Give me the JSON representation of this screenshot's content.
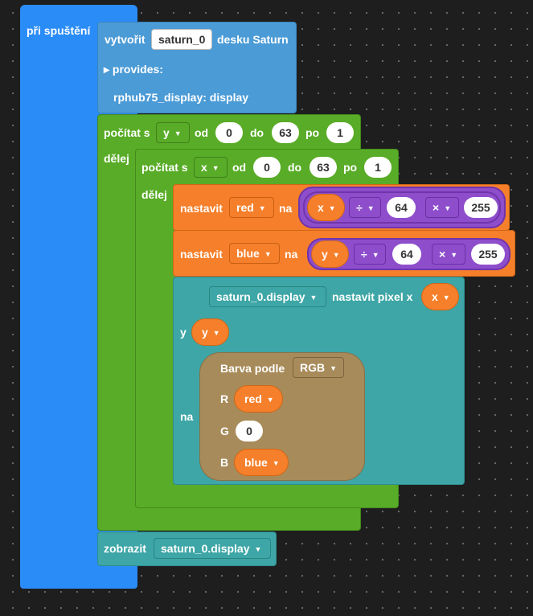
{
  "hat": {
    "label": "při spuštění"
  },
  "create": {
    "label": "vytvořit",
    "name_field": "saturn_0",
    "type_label": "desku Saturn",
    "provides_label": "▸ provides:",
    "provides_item": "rphub75_display: display"
  },
  "outer_loop": {
    "label": "počítat s",
    "var": "y",
    "from_label": "od",
    "from": "0",
    "to_label": "do",
    "to": "63",
    "step_label": "po",
    "step": "1",
    "do_label": "dělej"
  },
  "inner_loop": {
    "label": "počítat s",
    "var": "x",
    "from_label": "od",
    "from": "0",
    "to_label": "do",
    "to": "63",
    "step_label": "po",
    "step": "1",
    "do_label": "dělej"
  },
  "set_red": {
    "label": "nastavit",
    "var": "red",
    "to_label": "na",
    "operand": "x",
    "op1": "÷",
    "val1": "64",
    "op2": "×",
    "val2": "255"
  },
  "set_blue": {
    "label": "nastavit",
    "var": "blue",
    "to_label": "na",
    "operand": "y",
    "op1": "÷",
    "val1": "64",
    "op2": "×",
    "val2": "255"
  },
  "set_pixel": {
    "target": "saturn_0.display",
    "label": "nastavit pixel x",
    "x_var": "x",
    "y_label": "y",
    "y_var": "y",
    "color_label": "na"
  },
  "color": {
    "label": "Barva podle",
    "mode": "RGB",
    "r_label": "R",
    "r_var": "red",
    "g_label": "G",
    "g_val": "0",
    "b_label": "B",
    "b_var": "blue"
  },
  "show": {
    "label": "zobrazit",
    "target": "saturn_0.display"
  },
  "colors": {
    "events": "#2a8cf7",
    "board": "#4b9bd6",
    "loops": "#59ac27",
    "variables": "#f57f2a",
    "math": "#8e4ecb",
    "display": "#3ea6a6",
    "color": "#a88b5a"
  }
}
